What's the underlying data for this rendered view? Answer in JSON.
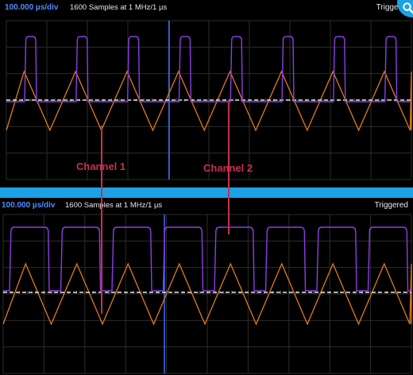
{
  "top_scope": {
    "timebase": "100.000 µs/div",
    "samples": "1600 Samples at 1 MHz/1 µs",
    "trigger_status": "Triggered"
  },
  "bottom_scope": {
    "timebase": "100.000 µs/div",
    "samples": "1600 Samples at 1 MHz/1 µs",
    "trigger_status": "Triggered"
  },
  "annotations": {
    "channel1": "Channel 1",
    "channel2": "Channel 2"
  },
  "icons": {
    "zoom": "magnifier-icon"
  },
  "colors": {
    "background": "#000000",
    "accent": "#1da1e6",
    "timebase_text": "#4f8cff",
    "channel_square": "#8a3fe0",
    "channel_triangle": "#e07b1a",
    "trigger_line": "#3a6cff",
    "annotation": "#c8304e"
  }
}
